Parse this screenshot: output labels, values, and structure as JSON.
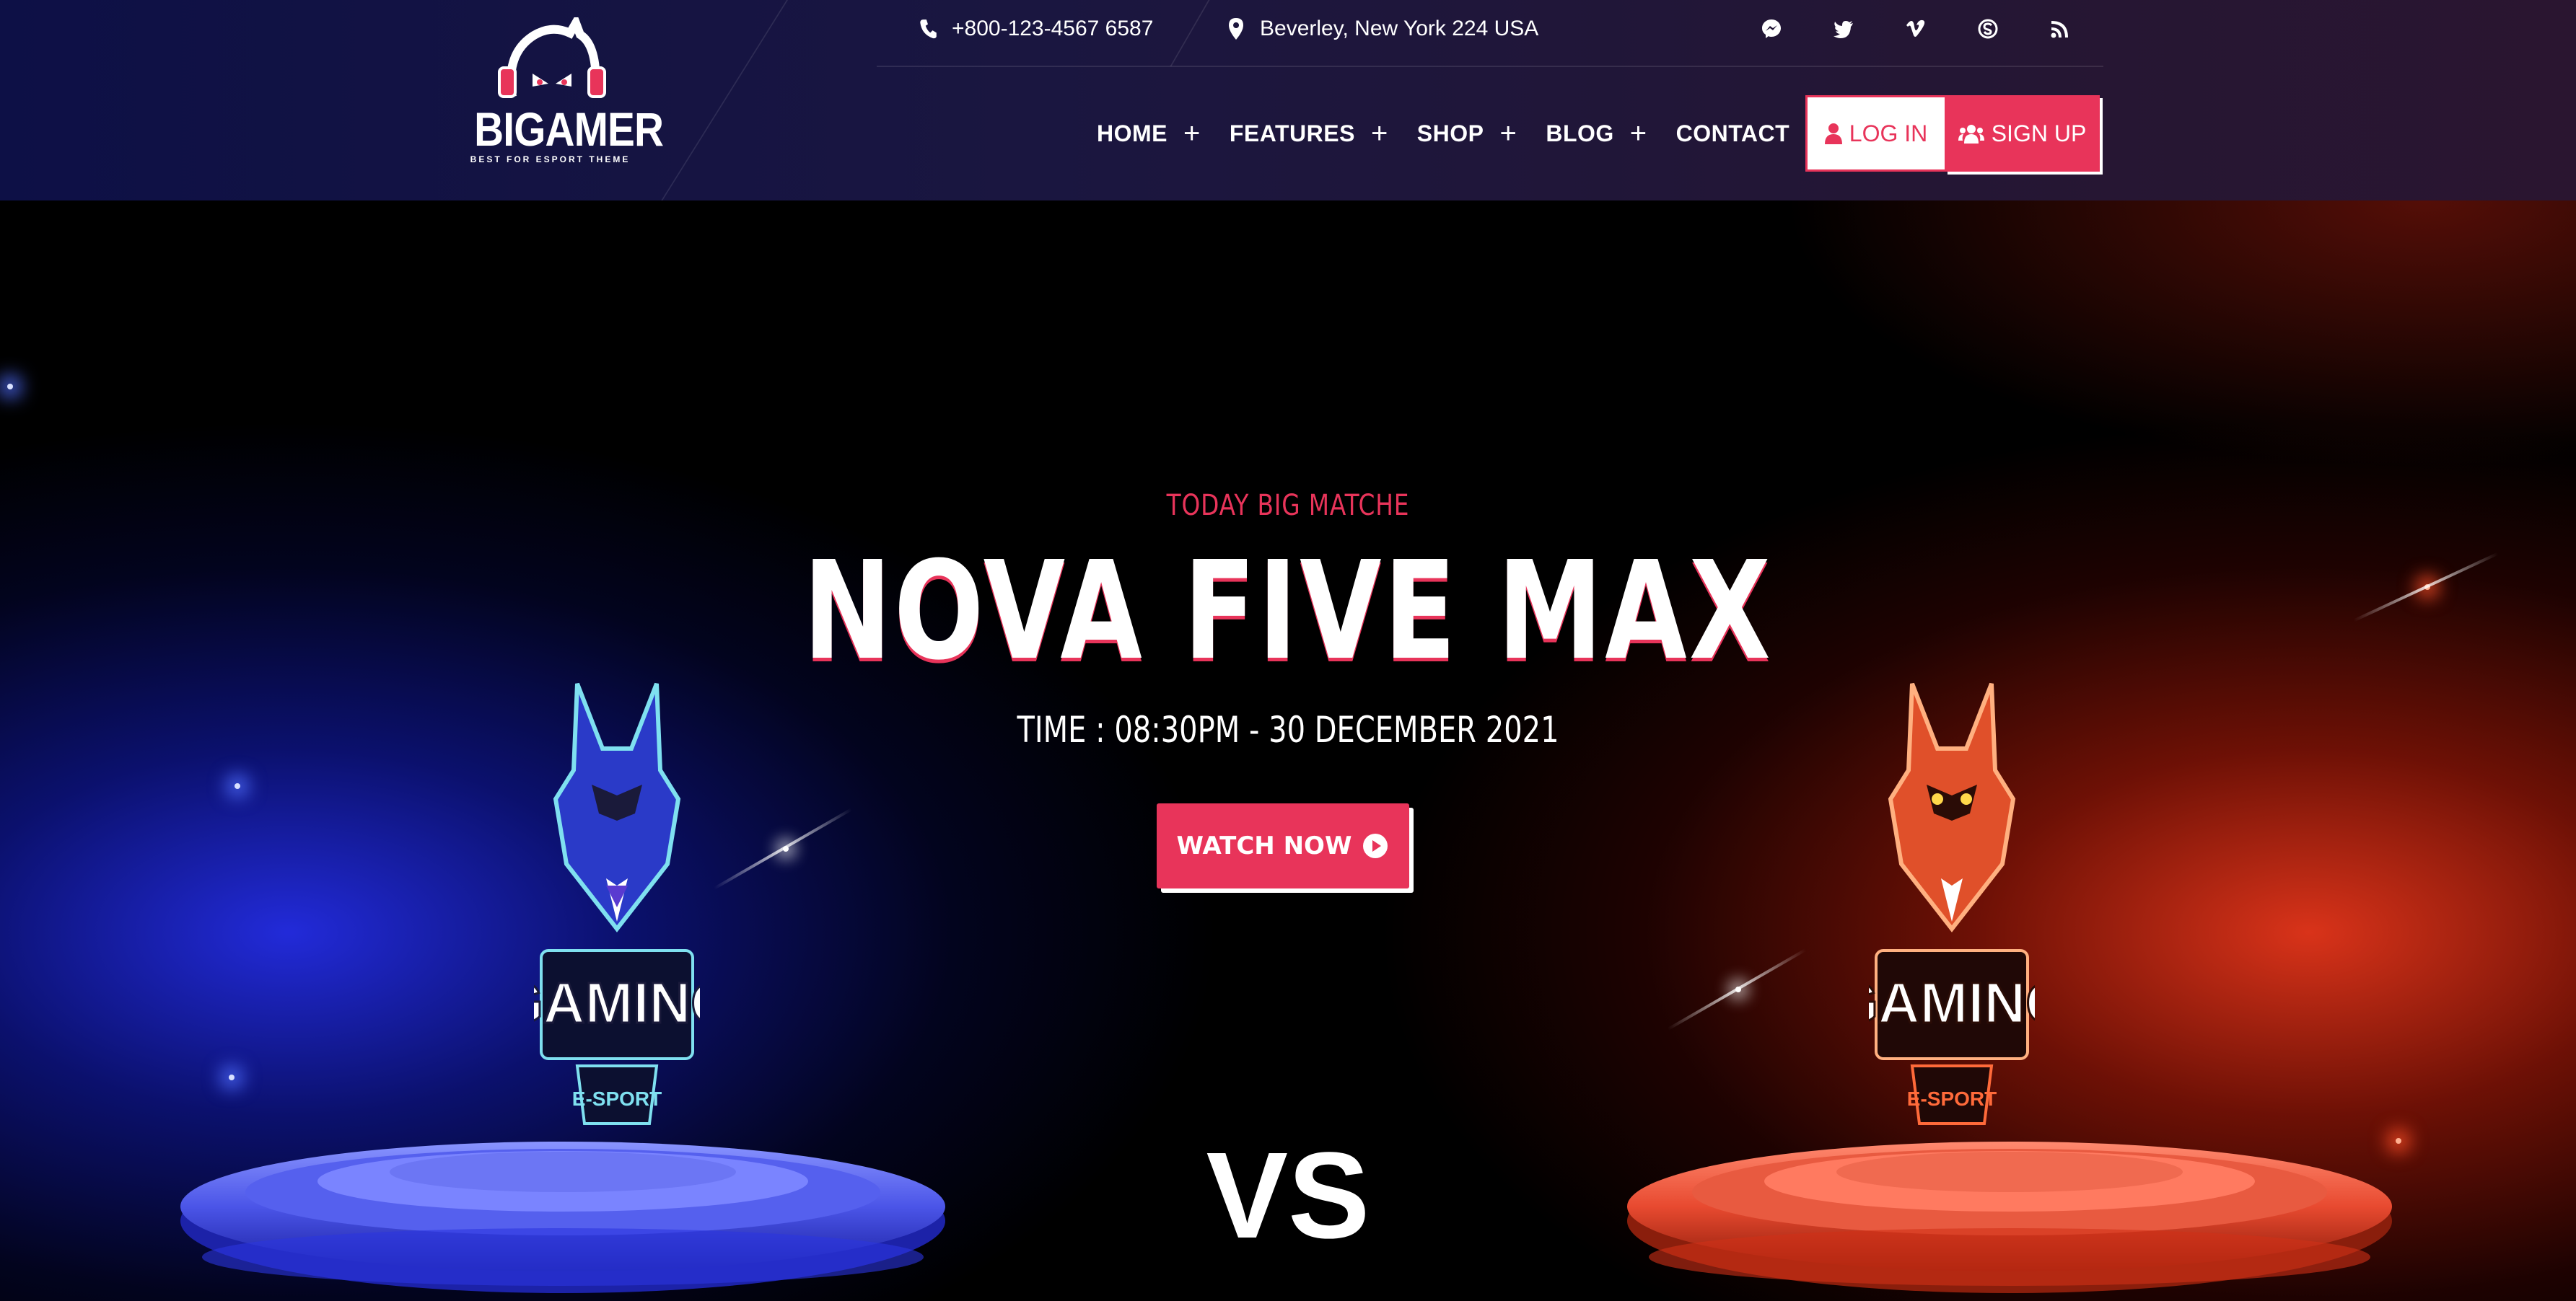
{
  "brand": {
    "name": "BIGAMER",
    "tagline": "BEST FOR ESPORT THEME"
  },
  "topbar": {
    "phone": "+800-123-4567 6587",
    "address": "Beverley, New York 224 USA",
    "social": [
      "messenger-icon",
      "twitter-icon",
      "vimeo-icon",
      "skype-icon",
      "rss-icon"
    ]
  },
  "nav": {
    "items": [
      {
        "label": "HOME",
        "has_submenu": true
      },
      {
        "label": "FEATURES",
        "has_submenu": true
      },
      {
        "label": "SHOP",
        "has_submenu": true
      },
      {
        "label": "BLOG",
        "has_submenu": true
      },
      {
        "label": "CONTACT",
        "has_submenu": false
      }
    ],
    "submenu_glyph": "+"
  },
  "auth": {
    "login_label": "LOG IN",
    "signup_label": "SIGN UP"
  },
  "hero": {
    "subtitle": "TODAY BIG MATCHE",
    "title": "NOVA FIVE MAX",
    "time": "TIME : 08:30PM - 30 DECEMBER 2021",
    "cta_label": "WATCH NOW",
    "versus": "VS",
    "team_left": {
      "logo_text": "GAMING",
      "sub_text": "E-SPORT",
      "color": "#3b4bff"
    },
    "team_right": {
      "logo_text": "GAMING",
      "sub_text": "E-SPORT",
      "color": "#ff4a2a"
    }
  },
  "colors": {
    "accent": "#e8345a",
    "header_bg": "#14123f",
    "blue_glow": "#2a36ff",
    "red_glow": "#ff3c1e"
  }
}
